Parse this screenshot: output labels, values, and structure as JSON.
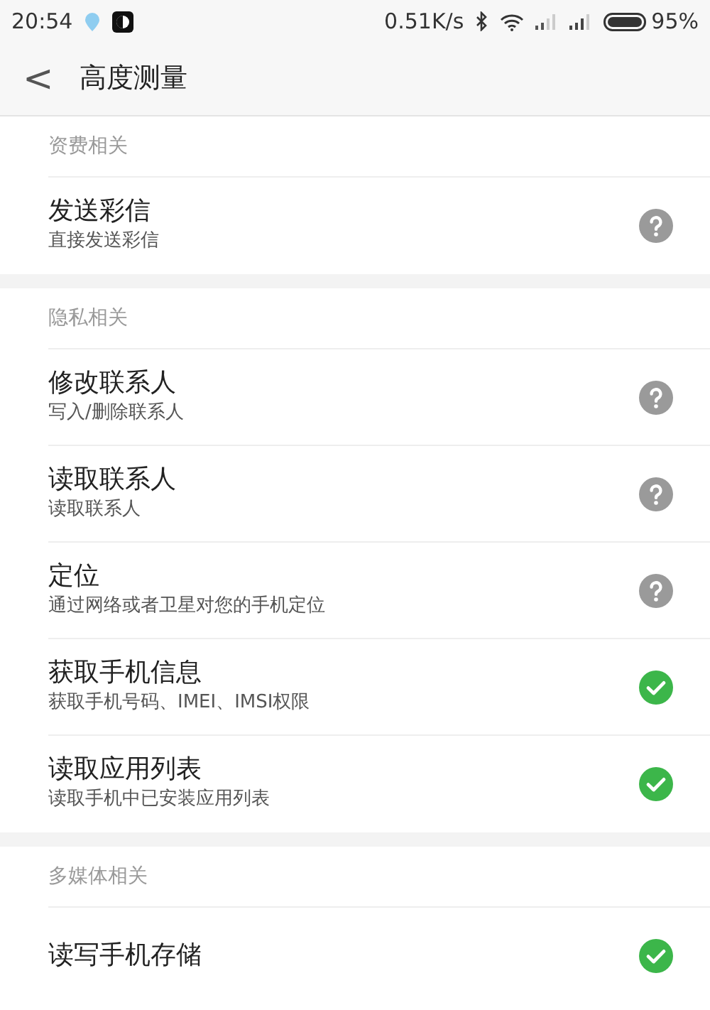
{
  "status_bar": {
    "time": "20:54",
    "speed": "0.51K/s",
    "battery": "95%"
  },
  "header": {
    "back": "<",
    "title": "高度测量"
  },
  "sections": [
    {
      "title": "资费相关",
      "items": [
        {
          "title": "发送彩信",
          "subtitle": "直接发送彩信",
          "granted": false
        }
      ]
    },
    {
      "title": "隐私相关",
      "items": [
        {
          "title": "修改联系人",
          "subtitle": "写入/删除联系人",
          "granted": false
        },
        {
          "title": "读取联系人",
          "subtitle": "读取联系人",
          "granted": false
        },
        {
          "title": "定位",
          "subtitle": "通过网络或者卫星对您的手机定位",
          "granted": false
        },
        {
          "title": "获取手机信息",
          "subtitle": "获取手机号码、IMEI、IMSI权限",
          "granted": true
        },
        {
          "title": "读取应用列表",
          "subtitle": "读取手机中已安装应用列表",
          "granted": true
        }
      ]
    },
    {
      "title": "多媒体相关",
      "items": [
        {
          "title": "读写手机存储",
          "granted": true
        }
      ]
    }
  ]
}
